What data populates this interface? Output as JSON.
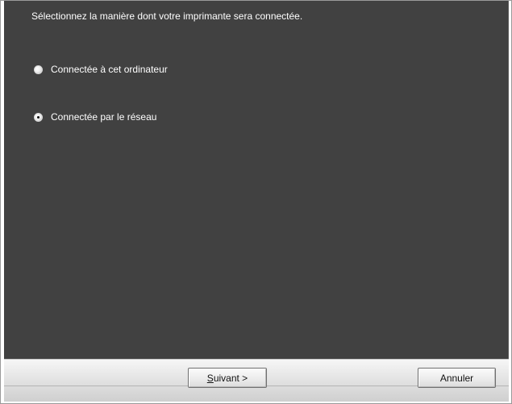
{
  "panel": {
    "instruction": "Sélectionnez la manière dont votre imprimante sera connectée."
  },
  "options": [
    {
      "label": "Connectée à cet ordinateur",
      "selected": false
    },
    {
      "label": "Connectée par le réseau",
      "selected": true
    }
  ],
  "buttons": {
    "next_mnemonic": "S",
    "next_rest": "uivant >",
    "cancel": "Annuler"
  }
}
